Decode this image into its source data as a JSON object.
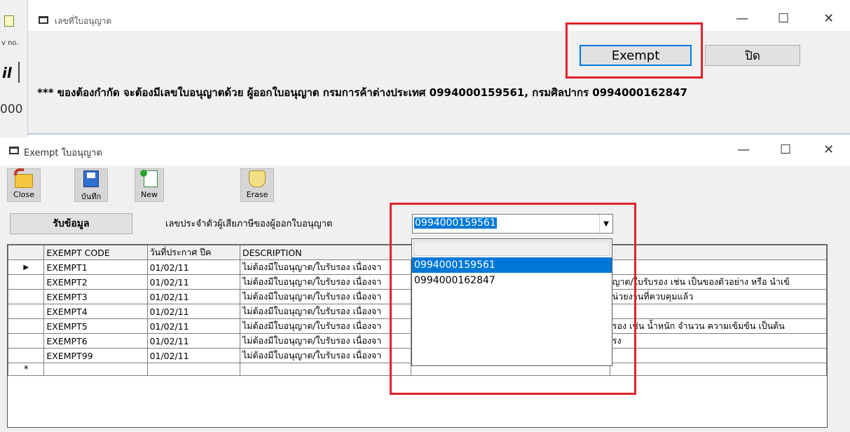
{
  "bg_app": {
    "text1": "v no.",
    "text2": "il",
    "text3": "000"
  },
  "license_window": {
    "title": "เลขที่ใบอนุญาต",
    "exempt_button": "Exempt",
    "close_button": "ปิด",
    "notice": "*** ของต้องกำกัด จะต้องมีเลขใบอนุญาตด้วย ผู้ออกใบอนุญาต   กรมการค้าต่างประเทศ  0994000159561,   กรมศิลปากร  0994000162847",
    "controls": {
      "minimize": "—",
      "maximize": "☐",
      "close": "✕"
    }
  },
  "exempt_window": {
    "title": "Exempt ใบอนุญาต",
    "controls": {
      "minimize": "—",
      "maximize": "☐",
      "close": "✕"
    },
    "toolbar": [
      {
        "label": "Close",
        "icon": "folder-back-icon"
      },
      {
        "label": "บันทึก",
        "icon": "save-icon"
      },
      {
        "label": "New",
        "icon": "new-document-icon"
      },
      {
        "label": "Erase",
        "icon": "eraser-icon"
      }
    ],
    "fetch_button": "รับข้อมูล",
    "tax_label": "เลขประจำตัวผู้เสียภาษีของผู้ออกใบอนุญาต",
    "tax_value": "0994000159561",
    "dropdown_options": [
      "0994000159561",
      "0994000162847"
    ],
    "table": {
      "columns": [
        "EXEMPT CODE",
        "วันที่ประกาศ ปีค",
        "DESCRIPTION"
      ],
      "rows": [
        {
          "code": "EXEMPT1",
          "date": "01/02/11",
          "desc": "ไม่ต้องมีใบอนุญาต/ใบรับรอง เนื่องจา",
          "more": ""
        },
        {
          "code": "EXEMPT2",
          "date": "01/02/11",
          "desc": "ไม่ต้องมีใบอนุญาต/ใบรับรอง เนื่องจา",
          "more": "ญาต/ใบรับรอง เช่น เป็นของตัวอย่าง หรือ นำเข้"
        },
        {
          "code": "EXEMPT3",
          "date": "01/02/11",
          "desc": "ไม่ต้องมีใบอนุญาต/ใบรับรอง เนื่องจา",
          "more": "น่วยงานที่ควบคุมแล้ว"
        },
        {
          "code": "EXEMPT4",
          "date": "01/02/11",
          "desc": "ไม่ต้องมีใบอนุญาต/ใบรับรอง เนื่องจา",
          "more": ""
        },
        {
          "code": "EXEMPT5",
          "date": "01/02/11",
          "desc": "ไม่ต้องมีใบอนุญาต/ใบรับรอง เนื่องจา",
          "more": "รอง เช่น น้ำหนัก จำนวน ความเข้มข้น เป็นต้น"
        },
        {
          "code": "EXEMPT6",
          "date": "01/02/11",
          "desc": "ไม่ต้องมีใบอนุญาต/ใบรับรอง เนื่องจา",
          "more": "รง"
        },
        {
          "code": "EXEMPT99",
          "date": "01/02/11",
          "desc": "ไม่ต้องมีใบอนุญาต/ใบรับรอง เนื่องจา",
          "more": ""
        }
      ],
      "current_row_marker": "▶",
      "new_row_marker": "*"
    }
  },
  "colors": {
    "highlight": "#0078d7",
    "annotation_box": "#e2222a"
  }
}
